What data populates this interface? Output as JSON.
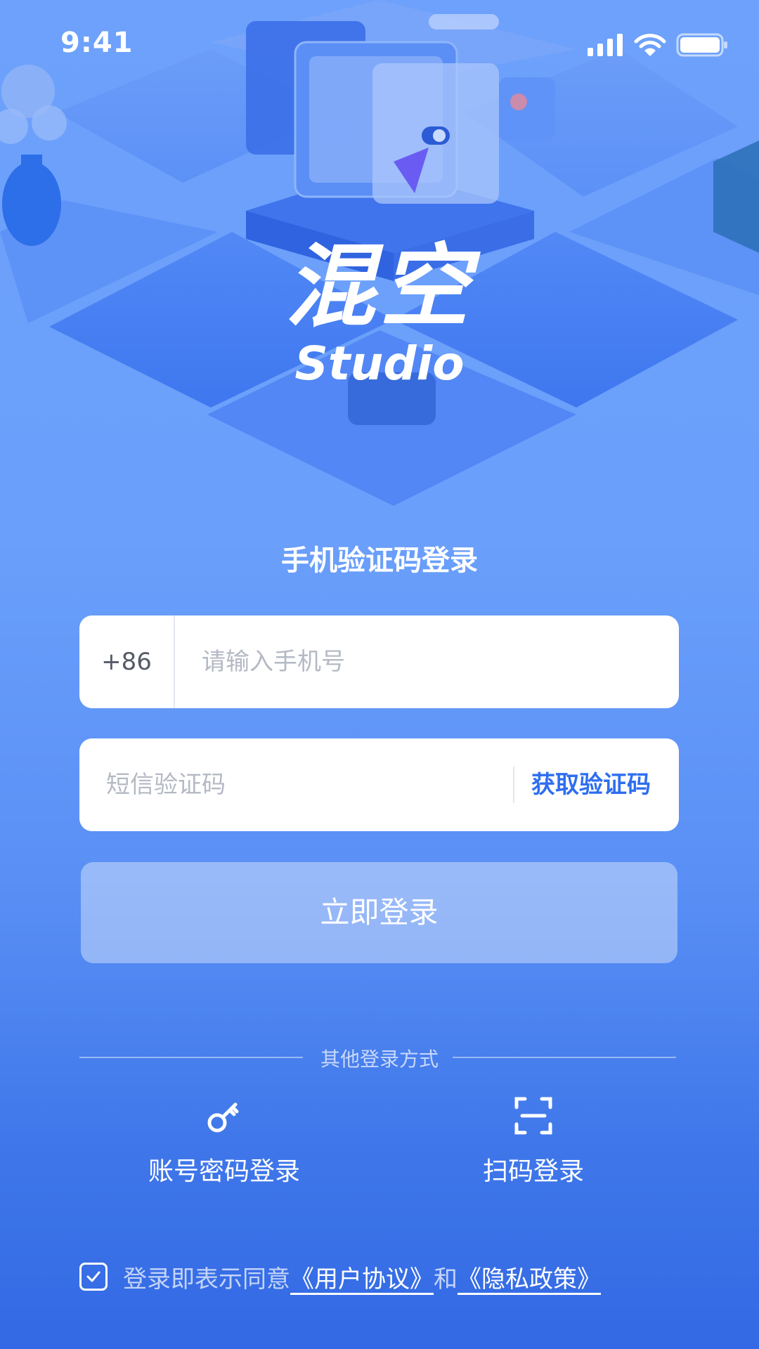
{
  "status_bar": {
    "time": "9:41"
  },
  "logo": {
    "cn": "混空",
    "en": "Studio"
  },
  "title": "手机验证码登录",
  "phone": {
    "country_code": "+86",
    "placeholder": "请输入手机号"
  },
  "sms": {
    "placeholder": "短信验证码",
    "get_code": "获取验证码"
  },
  "login_button": "立即登录",
  "other_methods": {
    "label": "其他登录方式",
    "items": [
      {
        "label": "账号密码登录",
        "icon": "key-icon"
      },
      {
        "label": "扫码登录",
        "icon": "scan-icon"
      }
    ]
  },
  "agreement": {
    "checked": true,
    "prefix": "登录即表示同意",
    "user_agreement": "《用户协议》",
    "and": "和",
    "privacy_policy": "《隐私政策》"
  },
  "colors": {
    "accent": "#2e6ef0",
    "background_top": "#6da1fb",
    "background_bottom": "#3369e4"
  }
}
